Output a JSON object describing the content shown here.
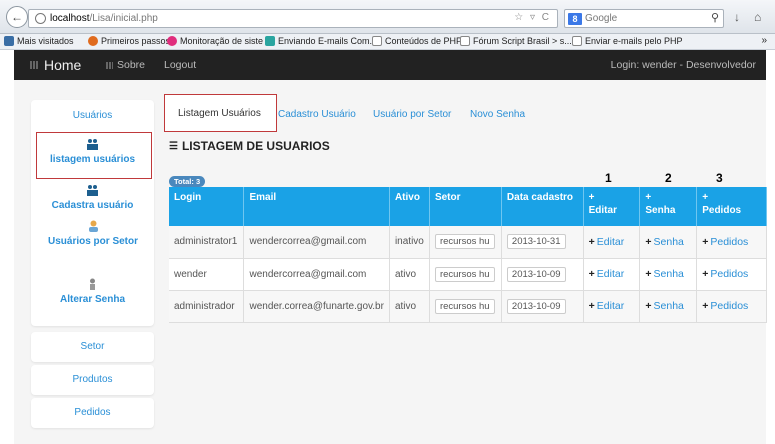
{
  "browser": {
    "url_host": "localhost",
    "url_path": "/Lisa/inicial.php",
    "search_placeholder": "Google",
    "bookmarks": [
      "Mais visitados",
      "Primeiros passos",
      "Monitoração de siste",
      "Enviando E-mails Com...",
      "Conteúdos de PHP",
      "Fórum Script Brasil > s...",
      "Enviar e-mails pelo PHP"
    ]
  },
  "navbar": {
    "brand": "Home",
    "links": [
      "Sobre",
      "Logout"
    ],
    "login": "Login: wender - Desenvolvedor"
  },
  "sidebar": {
    "title": "Usuários",
    "items": [
      "listagem usuários",
      "Cadastra usuário",
      "Usuários por Setor",
      "Alterar Senha"
    ],
    "buttons": [
      "Setor",
      "Produtos",
      "Pedidos"
    ]
  },
  "tabs": [
    "Listagem Usuários",
    "Cadastro Usuário",
    "Usuário por Setor",
    "Novo Senha"
  ],
  "section_title": "LISTAGEM DE USUARIOS",
  "total_badge": "Total: 3",
  "column_numbers": [
    "1",
    "2",
    "3"
  ],
  "table": {
    "headers": [
      "Login",
      "Email",
      "Ativo",
      "Setor",
      "Data cadastro",
      "Editar",
      "Senha",
      "Pedidos"
    ],
    "plus": "+",
    "rows": [
      {
        "login": "administrator1",
        "email": "wendercorrea@gmail.com",
        "ativo": "inativo",
        "setor": "recursos hu",
        "data": "2013-10-31",
        "editar": "Editar",
        "senha": "Senha",
        "pedidos": "Pedidos"
      },
      {
        "login": "wender",
        "email": "wendercorrea@gmail.com",
        "ativo": "ativo",
        "setor": "recursos hu",
        "data": "2013-10-09",
        "editar": "Editar",
        "senha": "Senha",
        "pedidos": "Pedidos"
      },
      {
        "login": "administrador",
        "email": "wender.correa@funarte.gov.br",
        "ativo": "ativo",
        "setor": "recursos hu",
        "data": "2013-10-09",
        "editar": "Editar",
        "senha": "Senha",
        "pedidos": "Pedidos"
      }
    ]
  },
  "colors": {
    "accent": "#2a8fd6",
    "table_header": "#1aa2e6",
    "navbar": "#222222",
    "highlight_box": "#c0393b"
  }
}
